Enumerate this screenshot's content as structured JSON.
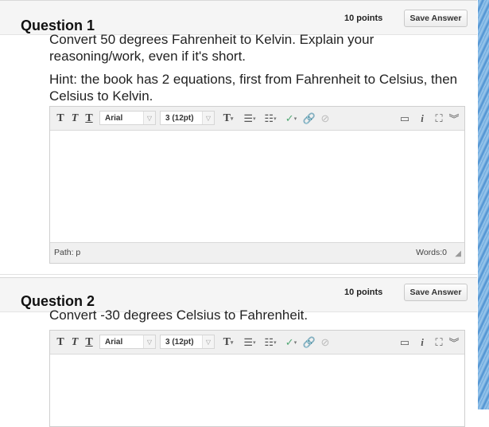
{
  "questions": [
    {
      "title": "Question 1",
      "points": "10 points",
      "save_label": "Save Answer",
      "text": "Convert 50 degrees Fahrenheit to Kelvin.  Explain your reasoning/work, even if it's short.",
      "hint": "Hint:  the book has 2 equations, first from Fahrenheit to Celsius, then Celsius to Kelvin.",
      "font_family": "Arial",
      "font_size": "3 (12pt)",
      "path_label": "Path: p",
      "words_label": "Words:0"
    },
    {
      "title": "Question 2",
      "points": "10 points",
      "save_label": "Save Answer",
      "text": "Convert -30 degrees Celsius to Fahrenheit.",
      "font_family": "Arial",
      "font_size": "3 (12pt)"
    }
  ],
  "icons": [
    "bold-t-icon",
    "italic-t-icon",
    "underline-t-icon",
    "text-color-icon",
    "bullet-list-icon",
    "numbered-list-icon",
    "spellcheck-icon",
    "link-icon",
    "unlink-icon",
    "preview-icon",
    "info-icon",
    "fullscreen-icon",
    "collapse-icon"
  ]
}
